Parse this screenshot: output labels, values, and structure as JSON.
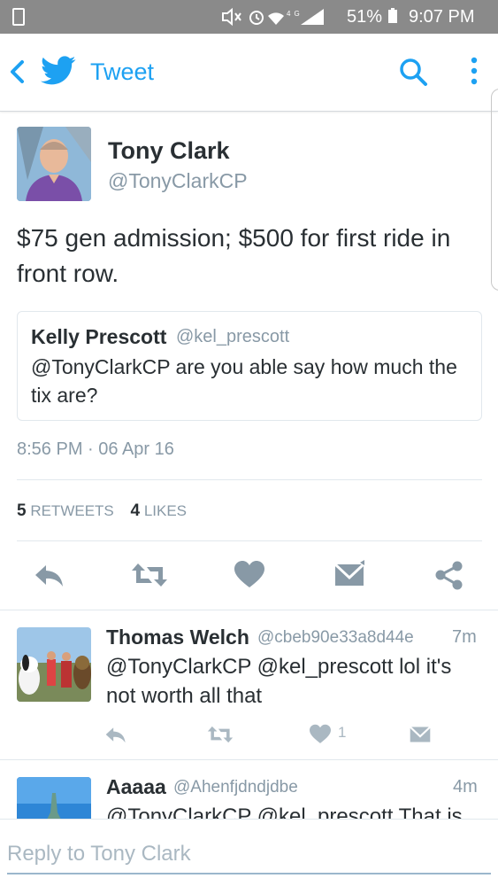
{
  "status_bar": {
    "battery": "51%",
    "time": "9:07 PM",
    "icons": "mute-icon alarm-icon wifi-icon lte-icon signal-icon battery-icon"
  },
  "app_bar": {
    "title": "Tweet",
    "back_icon": "back-chevron-icon",
    "logo_icon": "twitter-bird-icon",
    "search_icon": "search-icon",
    "more_icon": "more-vert-icon"
  },
  "tweet": {
    "author_name": "Tony Clark",
    "author_handle": "@TonyClarkCP",
    "text": "$75 gen admission; $500 for first ride in front row.",
    "quoted": {
      "author_name": "Kelly Prescott",
      "author_handle": "@kel_prescott",
      "text": "@TonyClarkCP are you able say how much the tix are?"
    },
    "timestamp": "8:56 PM · 06 Apr 16",
    "retweets_count": "5",
    "retweets_label": "RETWEETS",
    "likes_count": "4",
    "likes_label": "LIKES",
    "actions": [
      "reply-icon",
      "retweet-icon",
      "like-heart-icon",
      "direct-message-icon",
      "share-icon"
    ]
  },
  "replies": [
    {
      "author_name": "Thomas Welch",
      "author_handle": "@cbeb90e33a8d44e",
      "time": "7m",
      "text": "@TonyClarkCP @kel_prescott lol it's not worth all that",
      "like_count": "1"
    },
    {
      "author_name": "Aaaaa",
      "author_handle": "@Ahenfjdndjdbe",
      "time": "4m",
      "text": "@TonyClarkCP @kel_prescott That is"
    }
  ],
  "composer": {
    "placeholder": "Reply to Tony Clark"
  },
  "colors": {
    "brand": "#1da1f2",
    "action_icon": "#8899a6",
    "text": "#292f33",
    "muted": "#8899a6",
    "status_bar": "#8a8a8a"
  }
}
